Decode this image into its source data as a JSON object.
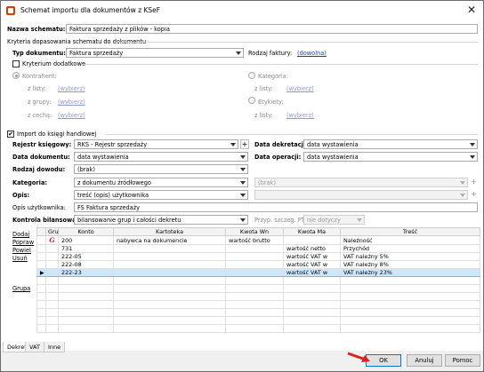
{
  "window": {
    "title": "Schemat importu dla dokumentów z KSeF",
    "close": "✕"
  },
  "header": {
    "name_label": "Nazwa schematu:",
    "name_value": "Faktura sprzedaży z plików - kopia"
  },
  "criteria": {
    "group_label": "Kryteria dopasowania schematu do dokumentu",
    "doc_type_label": "Typ dokumentu:",
    "doc_type_value": "Faktura sprzedaży",
    "invoice_kind_label": "Rodzaj faktury:",
    "invoice_kind_value": "(dowolna)",
    "additional_label": "Kryterium dodatkowe",
    "contractor_label": "Kontrahent:",
    "from_list": "z listy:",
    "from_group": "z grupy:",
    "from_feature": "z cechą:",
    "choose": "(wybierz)",
    "category_label": "Kategoria:",
    "labels_label": "Etykiety:"
  },
  "import": {
    "checkbox_label": "Import do księgi handlowej",
    "checked": "✔",
    "register_label": "Rejestr księgowy:",
    "register_value": "RKS - Rejestr sprzedaży",
    "plus": "+",
    "decree_date_label": "Data dekretacji:",
    "decree_date_value": "data wystawienia",
    "doc_date_label": "Data dokumentu:",
    "doc_date_value": "data wystawienia",
    "op_date_label": "Data operacji:",
    "op_date_value": "data wystawienia",
    "proof_label": "Rodzaj dowodu:",
    "proof_value": "(brak)",
    "category_label": "Kategoria:",
    "category_value": "z dokumentu źródłowego",
    "category2_value": "(brak)",
    "desc_label": "Opis:",
    "desc_value": "treść (opis) użytkownika",
    "user_desc_label": "Opis użytkownika:",
    "user_desc_value": "FS Faktura sprzedaży",
    "balance_label": "Kontrola bilansowania:",
    "balance_value": "bilansowanie grup i całości dekretu",
    "settle_label": "Przyp. szczeg. PTI:",
    "settle_value": "nie dotyczy"
  },
  "side_links": [
    "Dodaj",
    "Popraw",
    "Powiel",
    "Usuń",
    "Grupa"
  ],
  "grid": {
    "columns": [
      "Gru",
      "Konto",
      "Kartoteka",
      "Kwota Wn",
      "Kwota Ma",
      "Treść"
    ],
    "rows": [
      {
        "group": "G",
        "konto": "200",
        "kartoteka": "nabywca na dokumencie",
        "wn": "wartość brutto",
        "ma": "",
        "tresc": "Należność"
      },
      {
        "group": "",
        "konto": "731",
        "kartoteka": "",
        "wn": "",
        "ma": "wartość netto",
        "tresc": "Przychód"
      },
      {
        "group": "",
        "konto": "222-05",
        "kartoteka": "",
        "wn": "",
        "ma": "wartość VAT w",
        "tresc": "VAT należny 5%"
      },
      {
        "group": "",
        "konto": "222-08",
        "kartoteka": "",
        "wn": "",
        "ma": "wartość VAT w",
        "tresc": "VAT należny 8%"
      },
      {
        "group": "",
        "konto": "222-23",
        "kartoteka": "",
        "wn": "",
        "ma": "wartość VAT w",
        "tresc": "VAT należny 23%"
      }
    ],
    "selected_marker": "▶"
  },
  "tabs": [
    "Dekret",
    "VAT",
    "Inne"
  ],
  "buttons": {
    "ok": "OK",
    "cancel": "Anuluj",
    "help": "Pomoc"
  },
  "colors": {
    "selection": "#cde6fb",
    "link": "#1a3fb0",
    "arrow": "#e0201c"
  }
}
